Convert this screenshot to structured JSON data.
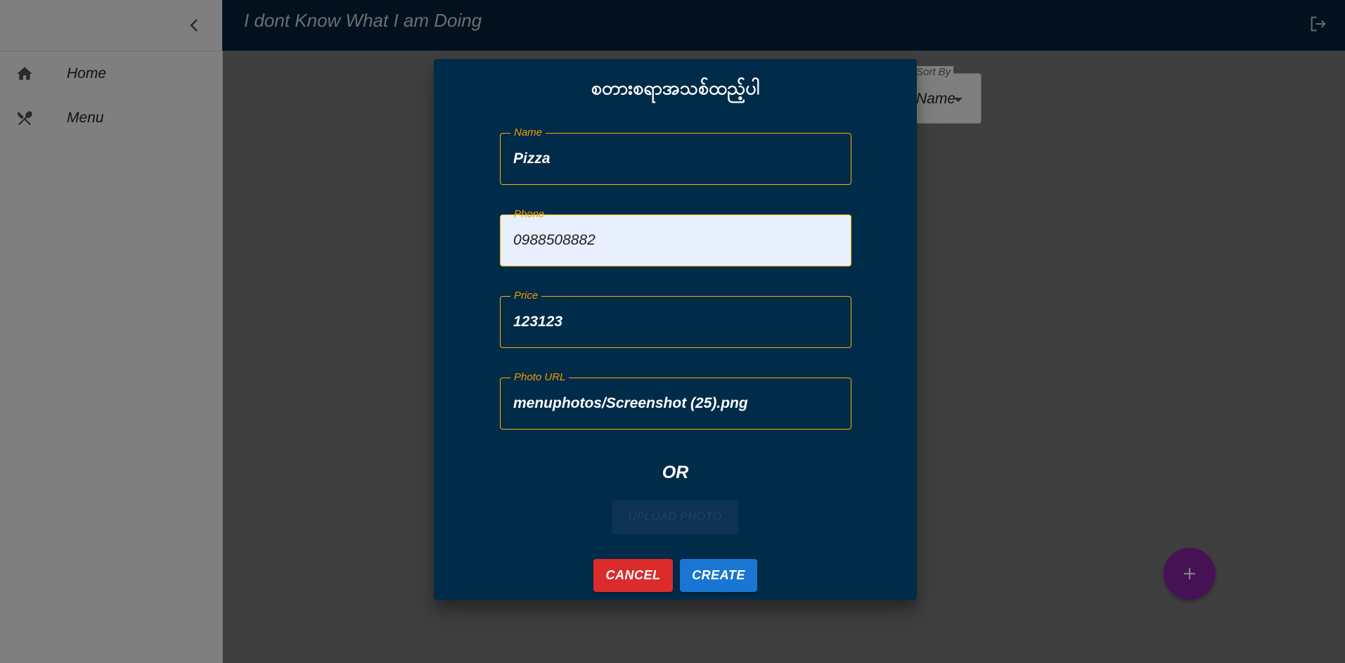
{
  "app": {
    "title": "I dont Know What I am Doing"
  },
  "sidebar": {
    "items": [
      {
        "label": "Home",
        "icon": "home-icon"
      },
      {
        "label": "Menu",
        "icon": "restaurant-icon"
      }
    ]
  },
  "sort": {
    "label": "Sort By",
    "value": "Name"
  },
  "dialog": {
    "title": "စတားစရာအသစ်ထည့်ပါ",
    "fields": {
      "name": {
        "label": "Name",
        "value": "Pizza"
      },
      "phone": {
        "label": "Phone",
        "value": "0988508882"
      },
      "price": {
        "label": "Price",
        "value": "123123"
      },
      "photo_url": {
        "label": "Photo URL",
        "value": "menuphotos/Screenshot (25).png"
      }
    },
    "or_text": "OR",
    "upload_label": "UPLOAD PHOTO",
    "cancel_label": "CANCEL",
    "create_label": "CREATE"
  },
  "colors": {
    "appbar": "#04223a",
    "dialog_bg": "#002b49",
    "field_border": "#f5b000",
    "field_label": "#f29b00",
    "cancel": "#dc2b2b",
    "create": "#1976d2",
    "fab": "#8e24aa"
  }
}
